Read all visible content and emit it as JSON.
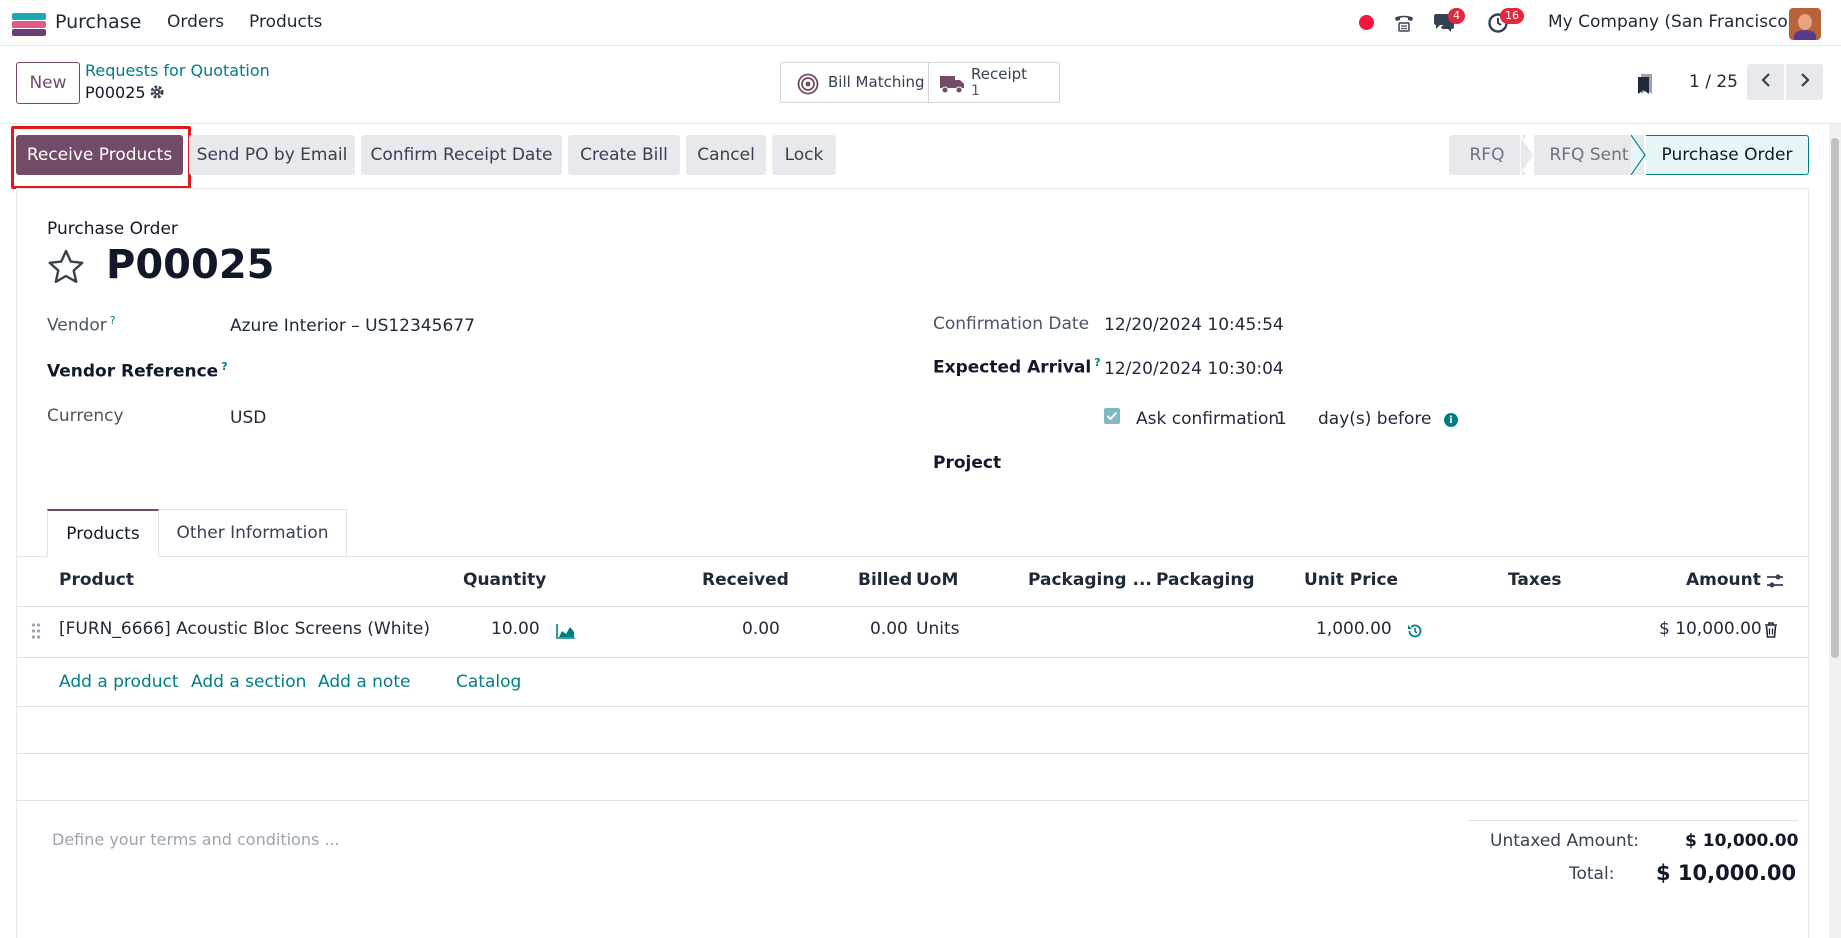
{
  "navbar": {
    "app_name": "Purchase",
    "menu": [
      "Orders",
      "Products"
    ],
    "chat_badge": "4",
    "activity_badge": "16",
    "company": "My Company (San Francisco)"
  },
  "control_panel": {
    "new_label": "New",
    "breadcrumb_parent": "Requests for Quotation",
    "record_name": "P00025",
    "smart_buttons": {
      "bill_matching": "Bill Matching",
      "receipt_label": "Receipt",
      "receipt_count": "1"
    },
    "pager": "1 / 25"
  },
  "actions": {
    "receive_products": "Receive Products",
    "send_po_email": "Send PO by Email",
    "confirm_receipt_date": "Confirm Receipt Date",
    "create_bill": "Create Bill",
    "cancel": "Cancel",
    "lock": "Lock"
  },
  "statusbar": {
    "stages": [
      "RFQ",
      "RFQ Sent",
      "Purchase Order"
    ],
    "active": "Purchase Order"
  },
  "form": {
    "doc_type": "Purchase Order",
    "name": "P00025",
    "vendor_label": "Vendor",
    "vendor_value": "Azure Interior – US12345677",
    "vendor_ref_label": "Vendor Reference",
    "currency_label": "Currency",
    "currency_value": "USD",
    "confirmation_date_label": "Confirmation Date",
    "confirmation_date_value": "12/20/2024 10:45:54",
    "expected_arrival_label": "Expected Arrival",
    "expected_arrival_value": "12/20/2024 10:30:04",
    "ask_confirmation_label": "Ask confirmation",
    "ask_confirmation_days": "1",
    "days_before_label": "day(s) before",
    "project_label": "Project",
    "help_mark": "?"
  },
  "tabs": [
    "Products",
    "Other Information"
  ],
  "table": {
    "headers": [
      "Product",
      "Quantity",
      "Received",
      "Billed",
      "UoM",
      "Packaging ...",
      "Packaging",
      "Unit Price",
      "Taxes",
      "Amount"
    ],
    "rows": [
      {
        "product": "[FURN_6666] Acoustic Bloc Screens (White)",
        "quantity": "10.00",
        "received": "0.00",
        "billed": "0.00",
        "uom": "Units",
        "unit_price": "1,000.00",
        "amount": "$ 10,000.00"
      }
    ],
    "add_links": [
      "Add a product",
      "Add a section",
      "Add a note",
      "Catalog"
    ]
  },
  "footer": {
    "terms_placeholder": "Define your terms and conditions ...",
    "untaxed_label": "Untaxed Amount:",
    "untaxed_value": "$ 10,000.00",
    "total_label": "Total:",
    "total_value": "$ 10,000.00"
  },
  "colors": {
    "brand": "#714b67",
    "link": "#017e84",
    "badge": "#e0293f",
    "highlight": "#e0181b"
  }
}
